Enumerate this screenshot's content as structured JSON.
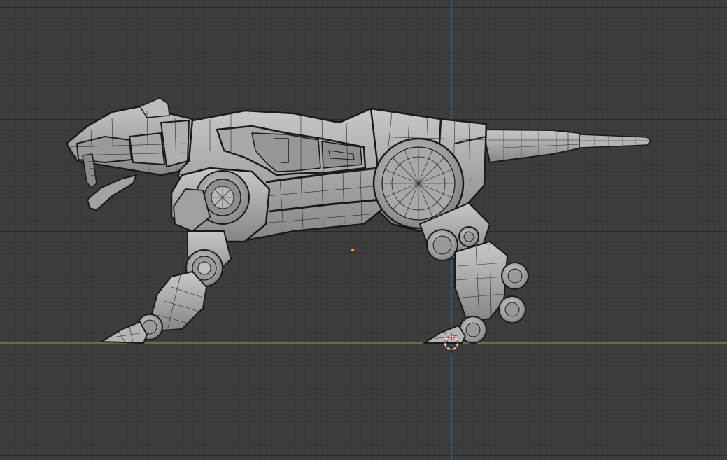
{
  "viewport": {
    "background_color": "#3d3d3d",
    "grid_line_color": "#2e2e2e",
    "x_axis_color": "#7a9f3a",
    "z_axis_color": "#3a6fb0",
    "cursor_color_a": "#e04a3a",
    "cursor_color_b": "#ffffff",
    "origin_dot_color": "#f0a040"
  },
  "model": {
    "name": "robot-sabertooth-tiger",
    "shading": "solid-wireframe",
    "surface_color": "#9c9c9c",
    "surface_light": "#c4c4c4",
    "edge_color": "#1c1c1c"
  },
  "icons": {
    "cursor": "3d-cursor-icon",
    "origin": "object-origin-icon"
  }
}
